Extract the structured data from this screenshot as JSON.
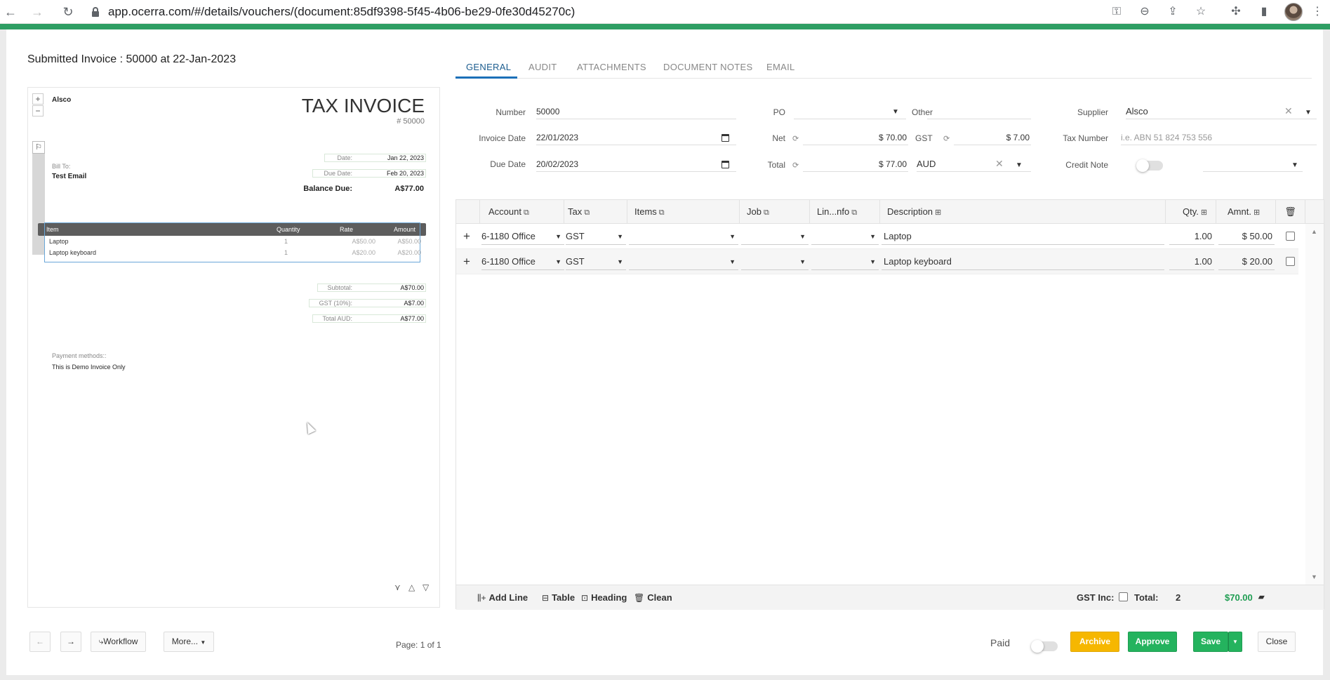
{
  "browser": {
    "url": "app.ocerra.com/#/details/vouchers/(document:85df9398-5f45-4b06-be29-0fe30d45270c)"
  },
  "page": {
    "title": "Submitted Invoice : 50000 at 22-Jan-2023"
  },
  "preview": {
    "company": "Alsco",
    "heading": "TAX INVOICE",
    "invoice_no": "# 50000",
    "bill_to_label": "Bill To:",
    "bill_to_name": "Test Email",
    "date_label": "Date:",
    "date_value": "Jan 22, 2023",
    "due_label": "Due Date:",
    "due_value": "Feb 20, 2023",
    "balance_label": "Balance Due:",
    "balance_value": "A$77.00",
    "columns": [
      "Item",
      "Quantity",
      "Rate",
      "Amount"
    ],
    "items": [
      {
        "name": "Laptop",
        "qty": "1",
        "rate": "A$50.00",
        "amount": "A$50.00"
      },
      {
        "name": "Laptop keyboard",
        "qty": "1",
        "rate": "A$20.00",
        "amount": "A$20.00"
      }
    ],
    "subtotal_label": "Subtotal:",
    "subtotal_value": "A$70.00",
    "gst_label": "GST (10%):",
    "gst_value": "A$7.00",
    "total_label": "Total AUD:",
    "total_value": "A$77.00",
    "payment_label": "Payment methods::",
    "payment_note": "This is Demo Invoice Only",
    "page_indicator": "Page: 1 of 1"
  },
  "tabs": [
    "GENERAL",
    "AUDIT",
    "ATTACHMENTS",
    "DOCUMENT NOTES",
    "EMAIL"
  ],
  "form": {
    "number_label": "Number",
    "number_value": "50000",
    "invoice_date_label": "Invoice Date",
    "invoice_date_value": "22/01/2023",
    "due_date_label": "Due Date",
    "due_date_value": "20/02/2023",
    "po_label": "PO",
    "other_label": "Other",
    "net_label": "Net",
    "net_value": "$ 70.00",
    "gst_label": "GST",
    "gst_value": "$ 7.00",
    "total_label": "Total",
    "total_value": "$ 77.00",
    "currency_value": "AUD",
    "supplier_label": "Supplier",
    "supplier_value": "Alsco",
    "tax_number_label": "Tax Number",
    "tax_number_placeholder": "i.e. ABN 51 824 753 556",
    "credit_note_label": "Credit Note"
  },
  "grid": {
    "columns": [
      "Account",
      "Tax",
      "Items",
      "Job",
      "Lin...nfo",
      "Description",
      "Qty.",
      "Amnt."
    ],
    "rows": [
      {
        "account": "6-1180 Office",
        "tax": "GST",
        "description": "Laptop",
        "qty": "1.00",
        "amount": "$ 50.00"
      },
      {
        "account": "6-1180 Office",
        "tax": "GST",
        "description": "Laptop keyboard",
        "qty": "1.00",
        "amount": "$ 20.00"
      }
    ],
    "footer": {
      "add_line": "Add Line",
      "table": "Table",
      "heading": "Heading",
      "clean": "Clean",
      "gst_inc_label": "GST Inc:",
      "total_label": "Total:",
      "total_count": "2",
      "total_amount": "$70.00"
    }
  },
  "actions": {
    "workflow": "Workflow",
    "more": "More...",
    "paid_label": "Paid",
    "archive": "Archive",
    "approve": "Approve",
    "save": "Save",
    "close": "Close"
  },
  "colors": {
    "brand_green": "#2e9e63",
    "approve_green": "#24b35e",
    "archive_yellow": "#f6b700",
    "tab_active": "#1c5d8f"
  }
}
